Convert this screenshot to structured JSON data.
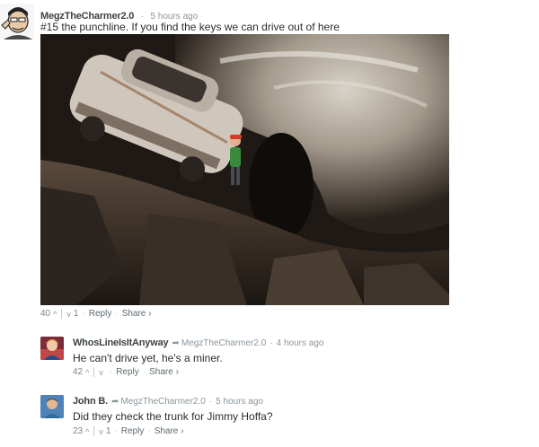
{
  "comments": [
    {
      "author": "MegzTheCharmer2.0",
      "time": "5 hours ago",
      "text": "#15 the punchline. If you find the keys we can drive out of here",
      "upvotes": "40",
      "downvotes": "1",
      "reply_label": "Reply",
      "share_label": "Share ›"
    },
    {
      "author": "WhosLineIsItAnyway",
      "reply_to": "MegzTheCharmer2.0",
      "time": "4 hours ago",
      "text": "He can't drive yet, he's a miner.",
      "upvotes": "42",
      "downvotes": "",
      "reply_label": "Reply",
      "share_label": "Share ›"
    },
    {
      "author": "John B.",
      "reply_to": "MegzTheCharmer2.0",
      "time": "5 hours ago",
      "text": "Did they check the trunk for Jimmy Hoffa?",
      "upvotes": "23",
      "downvotes": "1",
      "reply_label": "Reply",
      "share_label": "Share ›"
    }
  ],
  "symbols": {
    "dot": "·",
    "up": "^",
    "down": "v",
    "arrow": "➦"
  },
  "colors": {
    "author": "#3d4244",
    "meta": "#8a959c",
    "link": "#5f6a70"
  }
}
